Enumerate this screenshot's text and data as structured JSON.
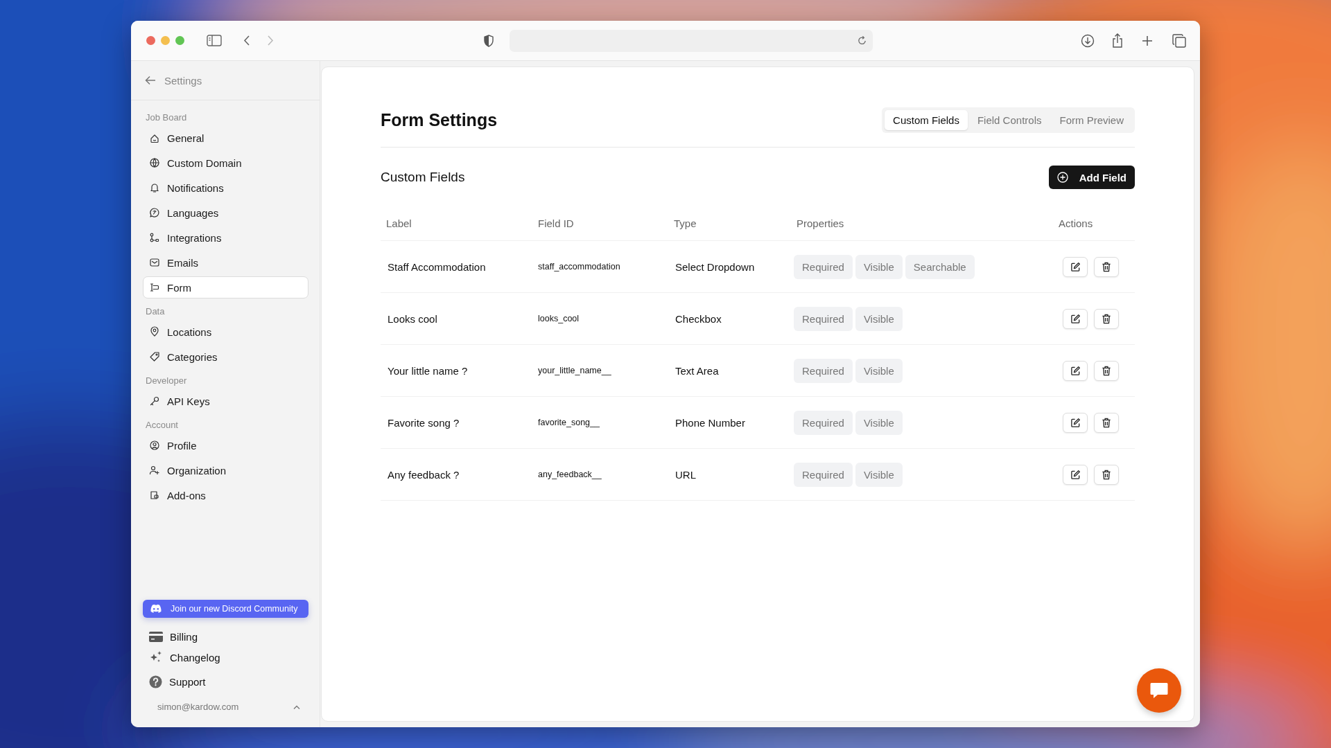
{
  "sidebar": {
    "back_label": "Settings",
    "sections": [
      {
        "title": "Job Board",
        "items": [
          {
            "label": "General",
            "selected": false
          },
          {
            "label": "Custom Domain",
            "selected": false
          },
          {
            "label": "Notifications",
            "selected": false
          },
          {
            "label": "Languages",
            "selected": false
          },
          {
            "label": "Integrations",
            "selected": false
          },
          {
            "label": "Emails",
            "selected": false
          },
          {
            "label": "Form",
            "selected": true
          }
        ]
      },
      {
        "title": "Data",
        "items": [
          {
            "label": "Locations",
            "selected": false
          },
          {
            "label": "Categories",
            "selected": false
          }
        ]
      },
      {
        "title": "Developer",
        "items": [
          {
            "label": "API Keys",
            "selected": false
          }
        ]
      },
      {
        "title": "Account",
        "items": [
          {
            "label": "Profile",
            "selected": false
          },
          {
            "label": "Organization",
            "selected": false
          },
          {
            "label": "Add-ons",
            "selected": false
          }
        ]
      }
    ],
    "banner": "Join our new Discord Community",
    "footer_links": [
      "Billing",
      "Changelog",
      "Support"
    ],
    "user_email": "simon@kardow.com"
  },
  "main": {
    "title": "Form Settings",
    "tabs": [
      {
        "label": "Custom Fields",
        "selected": true
      },
      {
        "label": "Field Controls",
        "selected": false
      },
      {
        "label": "Form Preview",
        "selected": false
      }
    ],
    "section_title": "Custom Fields",
    "add_button": "Add Field",
    "table": {
      "columns": [
        "Label",
        "Field ID",
        "Type",
        "Properties",
        "Actions"
      ],
      "rows": [
        {
          "label": "Staff Accommodation",
          "field_id": "staff_accommodation",
          "type": "Select Dropdown",
          "properties": [
            "Required",
            "Visible",
            "Searchable"
          ]
        },
        {
          "label": "Looks cool",
          "field_id": "looks_cool",
          "type": "Checkbox",
          "properties": [
            "Required",
            "Visible"
          ]
        },
        {
          "label": "Your little name ?",
          "field_id": "your_little_name__",
          "type": "Text Area",
          "properties": [
            "Required",
            "Visible"
          ]
        },
        {
          "label": "Favorite song ?",
          "field_id": "favorite_song__",
          "type": "Phone Number",
          "properties": [
            "Required",
            "Visible"
          ]
        },
        {
          "label": "Any feedback ?",
          "field_id": "any_feedback__",
          "type": "URL",
          "properties": [
            "Required",
            "Visible"
          ]
        }
      ]
    }
  }
}
